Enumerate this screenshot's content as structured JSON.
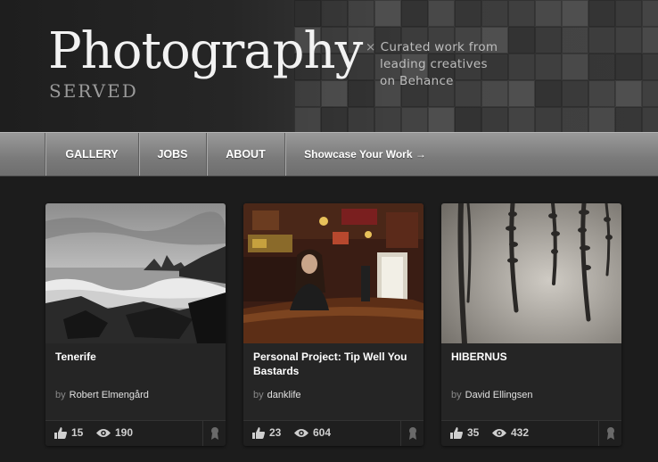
{
  "header": {
    "title": "Photography",
    "subtitle": "SERVED",
    "tagline_lines": [
      "Curated work from",
      "leading creatives",
      "on Behance"
    ]
  },
  "nav": {
    "gallery": "GALLERY",
    "jobs": "JOBS",
    "about": "ABOUT",
    "showcase": "Showcase Your Work →"
  },
  "projects": [
    {
      "title": "Tenerife",
      "by": "by",
      "author": "Robert Elmengård",
      "likes": "15",
      "views": "190"
    },
    {
      "title": "Personal Project: Tip Well You Bastards",
      "by": "by",
      "author": "danklife",
      "likes": "23",
      "views": "604"
    },
    {
      "title": "HIBERNUS",
      "by": "by",
      "author": "David Ellingsen",
      "likes": "35",
      "views": "432"
    }
  ],
  "icons": {
    "close": "close-icon",
    "like": "thumbs-up-icon",
    "views": "eye-icon",
    "feature": "ribbon-icon"
  },
  "colors": {
    "background": "#1c1c1c",
    "nav": "#8a8a8a",
    "card": "#252525"
  }
}
